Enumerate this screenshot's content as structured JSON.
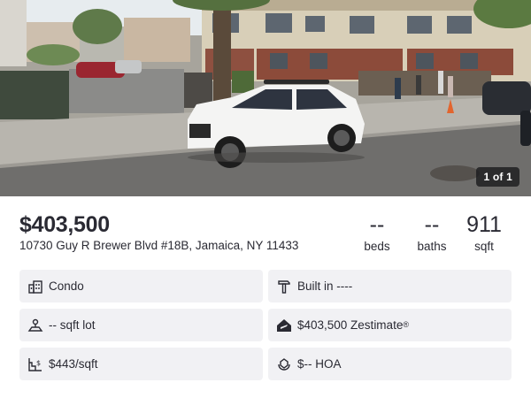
{
  "photo": {
    "counter": "1 of 1"
  },
  "summary": {
    "price": "$403,500",
    "address": "10730 Guy R Brewer Blvd #18B, Jamaica, NY 11433",
    "stats": [
      {
        "value": "--",
        "label": "beds"
      },
      {
        "value": "--",
        "label": "baths"
      },
      {
        "value": "911",
        "label": "sqft"
      }
    ]
  },
  "facts": {
    "type": {
      "icon": "building-icon",
      "text": "Condo"
    },
    "built": {
      "icon": "hammer-icon",
      "text": "Built in ----"
    },
    "lot": {
      "icon": "lot-size-icon",
      "text": "-- sqft lot"
    },
    "zestimate": {
      "icon": "zestimate-house-icon",
      "text": "$403,500 Zestimate",
      "mark": "®"
    },
    "price_per_sqft": {
      "icon": "price-per-sqft-icon",
      "text": "$443/sqft"
    },
    "hoa": {
      "icon": "hoa-icon",
      "text": "$-- HOA"
    }
  },
  "colors": {
    "text": "#2a2a33",
    "tile_background": "#f1f1f4",
    "counter_background": "#1c1c1e"
  }
}
